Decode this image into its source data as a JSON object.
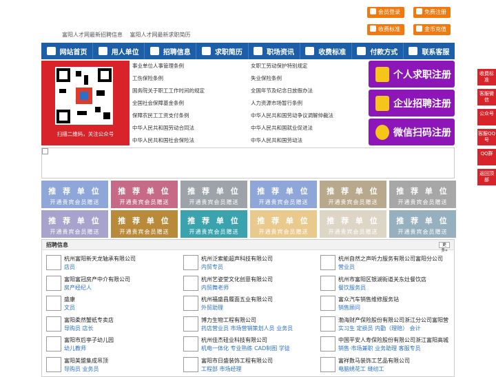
{
  "header": {
    "links": [
      "富阳人才网最新招聘信息",
      "富阳人才网最新求职简历"
    ],
    "buttons": [
      "会员登录",
      "免费注册",
      "收费标准",
      "金币充值"
    ]
  },
  "nav": {
    "items": [
      "网站首页",
      "用人单位",
      "招聘信息",
      "求职简历",
      "职场资讯",
      "收费标准",
      "付款方式",
      "联系客服"
    ]
  },
  "qr": {
    "caption": "扫描二维码，关注公众号"
  },
  "laws": {
    "left": [
      "事业单位人事管理条例",
      "工伤保险条例",
      "国务院关于职工工作时间的规定",
      "全国社会保障基金条例",
      "保障农民工工资支付条例",
      "中华人民共和国劳动合同法",
      "中华人民共和国社会保险法"
    ],
    "right": [
      "女职工劳动保护特别规定",
      "失业保险条例",
      "全国年节及纪念日放假办法",
      "人力资源市场暂行条例",
      "中华人民共和国劳动争议调解仲裁法",
      "中华人民共和国就业促进法",
      "中华人民共和国劳动法"
    ]
  },
  "register": {
    "job_seeker": "个人求职注册",
    "company": "企业招聘注册",
    "wechat": "微信扫码注册"
  },
  "tiles": {
    "title": "推 荐 单 位",
    "sub": "开通贵宾会员赠送",
    "colors": [
      "#8ea6d8",
      "#c76a88",
      "#9da3a8",
      "#8ea6d8",
      "#b8a98c",
      "#a7a7a7",
      "#a7a3cc",
      "#b98a3a",
      "#3aa3ae",
      "#eac98c",
      "#ddd6c6",
      "#96b0c0"
    ]
  },
  "jobs": {
    "title": "招聘信息",
    "more": "更多»",
    "items": [
      {
        "company": "杭州富阳新天龙轴承有限公司",
        "position": "店员"
      },
      {
        "company": "杭州泛索能超声科技有限公司",
        "position": "内贸专员"
      },
      {
        "company": "杭州自然之声听力服务有限公司富阳分公司",
        "position": "营业员"
      },
      {
        "company": "富阳富冠房产中介有限公司",
        "position": "房产经纪人"
      },
      {
        "company": "杭州艺姿堂文化创意有限公司",
        "position": "内贸舞老师"
      },
      {
        "company": "杭州市富阳区银湖街道关东灶餐饮店",
        "position": "餐饮服务员"
      },
      {
        "company": "盛康",
        "position": "文员"
      },
      {
        "company": "杭州福盛昌履面五业有限公司",
        "position": "外贸助理"
      },
      {
        "company": "富众汽车销售维修服务站",
        "position": "销售顾问"
      },
      {
        "company": "富阳柔然蟹纸专卖店",
        "position": "导购员 店长"
      },
      {
        "company": "博力生物工程有限公司",
        "position": "药店营业员 市场营销策划人员 业务员"
      },
      {
        "company": "渤海财产保险股份有限公司浙江分公司富阳营",
        "position": "实习生 定损员 内勤（理赔） 会计"
      },
      {
        "company": "富阳市后亭子幼儿园",
        "position": "幼儿教师"
      },
      {
        "company": "杭州佳杰硅业科技有限公司",
        "position": "机电一体化 专业熟练 CAD制图 学徒"
      },
      {
        "company": "中国平安人寿保险股份有限公司浙江富阳高城",
        "position": "销售·市场兼职 业务助理 客服专员"
      },
      {
        "company": "富阳美盟集成吊顶",
        "position": "导购员 业务员"
      },
      {
        "company": "富阳市日盛装饰工程有限公司",
        "position": "工程部 市场经理"
      },
      {
        "company": "富祥数马装饰工艺品有限公司",
        "position": "电脑绣花工 缝纫工"
      }
    ]
  },
  "side": [
    "收费标准",
    "客服微信",
    "公众号",
    "客服QQ号",
    "QQ群",
    "返回顶部"
  ]
}
